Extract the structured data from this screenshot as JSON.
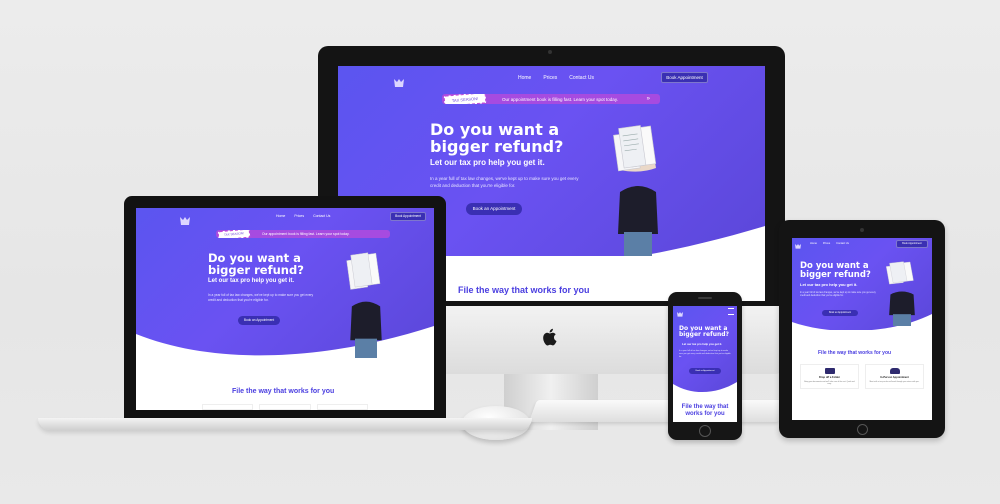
{
  "nav": {
    "home": "Home",
    "prices": "Prices",
    "contact": "Contact Us"
  },
  "book_button": "Book Appointment",
  "banner": {
    "stamp": "TAX SEASON!",
    "text": "Our appointment book is filling fast. Learn your spot today."
  },
  "hero": {
    "headline_line1": "Do you want a",
    "headline_line2": "bigger refund?",
    "subheadline": "Let our tax pro help you get it.",
    "body": "In a year full of tax law changes, we've kept up to make sure you get every credit and deduction that you're eligible for.",
    "cta": "Book an Appointment"
  },
  "section_title": "File the way that works for you",
  "tablet_cards": [
    {
      "title": "Drop off a Folder",
      "text": "Bring your documents and we'll take care of the rest. Quick and easy."
    },
    {
      "title": "In-Person Appointment",
      "text": "Meet with a tax pro who will work through your return with you."
    }
  ],
  "colors": {
    "primary": "#5b55f0",
    "dark_button": "#3a2fb3",
    "banner": "#a64be0",
    "heading": "#4a3ee0"
  }
}
